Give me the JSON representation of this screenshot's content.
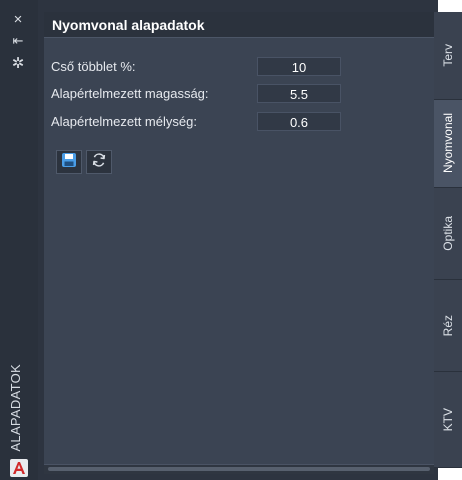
{
  "palette": {
    "side_title": "ALAPADATOK",
    "controls": {
      "close_icon": "×",
      "autohide_icon": "⇤",
      "settings_icon": "✲"
    }
  },
  "panel": {
    "title": "Nyomvonal alapadatok",
    "fields": [
      {
        "label": "Cső többlet %:",
        "value": "10"
      },
      {
        "label": "Alapértelmezett magasság:",
        "value": "5.5"
      },
      {
        "label": "Alapértelmezett mélység:",
        "value": "0.6"
      }
    ],
    "buttons": {
      "save_icon": "floppy-disk",
      "refresh_icon": "refresh"
    }
  },
  "tabs": [
    {
      "label": "Terv",
      "active": false
    },
    {
      "label": "Nyomvonal",
      "active": true
    },
    {
      "label": "Optika",
      "active": false
    },
    {
      "label": "Réz",
      "active": false
    },
    {
      "label": "KTV",
      "active": false
    }
  ],
  "colors": {
    "background": "#3b4453",
    "header": "#2b323d",
    "accent": "#4a9de6"
  }
}
